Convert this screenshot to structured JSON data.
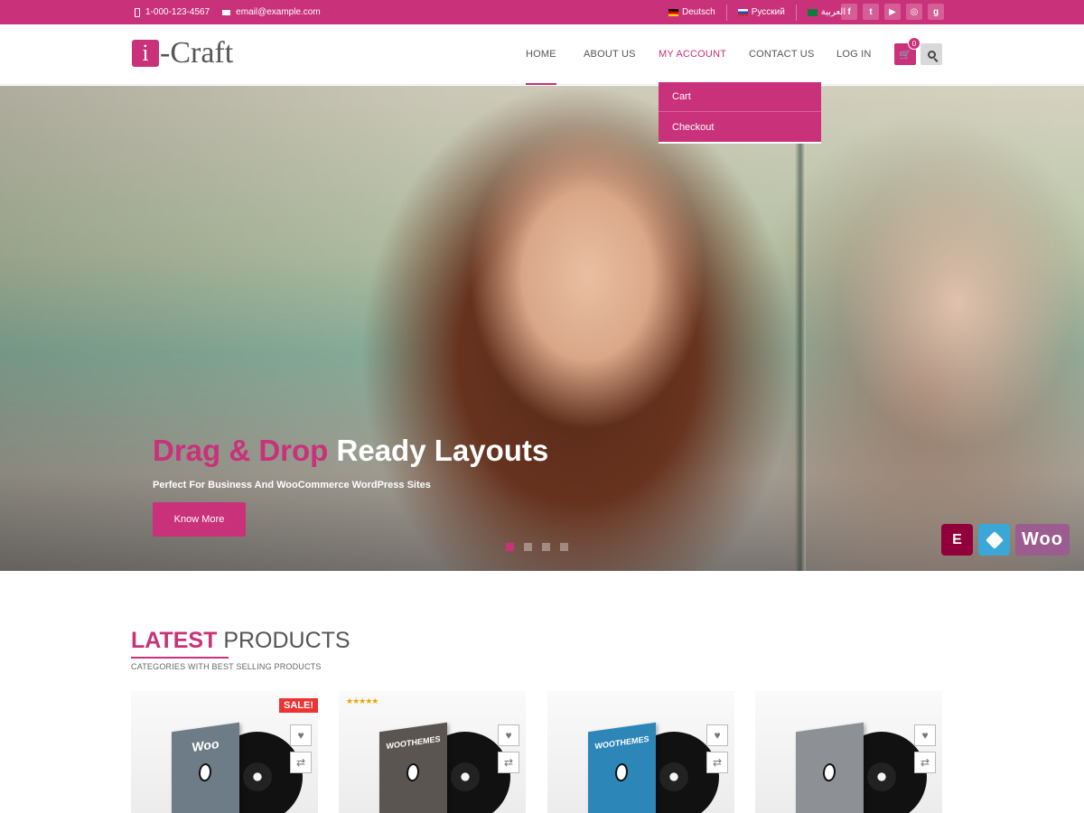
{
  "topbar": {
    "phone": "1-000-123-4567",
    "email": "email@example.com",
    "languages": [
      {
        "label": "Deutsch",
        "flag": "de-flag-icon"
      },
      {
        "label": "Русский",
        "flag": "ru-flag-icon"
      },
      {
        "label": "العربية",
        "flag": "sa-flag-icon"
      }
    ],
    "social": [
      {
        "icon": "facebook-icon",
        "glyph": "f"
      },
      {
        "icon": "twitter-icon",
        "glyph": "t"
      },
      {
        "icon": "youtube-icon",
        "glyph": "▶"
      },
      {
        "icon": "instagram-icon",
        "glyph": "◎"
      },
      {
        "icon": "google-plus-icon",
        "glyph": "g"
      }
    ]
  },
  "header": {
    "logo_letter": "i",
    "logo_text": "-Craft",
    "nav": [
      "HOME",
      "ABOUT US",
      "MY ACCOUNT",
      "CONTACT US",
      "LOG IN"
    ],
    "cart_count": "0"
  },
  "dropdown": {
    "items": [
      "Cart",
      "Checkout"
    ]
  },
  "hero": {
    "title_accent": "Drag & Drop",
    "title_rest": "Ready Layouts",
    "subtitle": "Perfect For Business And WooCommerce WordPress Sites",
    "button": "Know More",
    "slides": 4,
    "active_slide": 1,
    "badges": [
      "elementor-icon",
      "layers-icon",
      "woo-icon"
    ],
    "woo_text": "Woo",
    "elementor_glyph": "E"
  },
  "products": {
    "title_accent": "LATEST",
    "title_rest": "PRODUCTS",
    "subtitle": "CATEGORIES WITH BEST SELLING PRODUCTS",
    "sale_label": "SALE!",
    "stars": "★★★★★",
    "cards": [
      {
        "sleeve_text": "Woo",
        "sleeve_color": "#6d7c86",
        "sale": true,
        "rated": false
      },
      {
        "sleeve_text": "WOOTHEMES",
        "sleeve_color": "#5a5550",
        "sale": false,
        "rated": true
      },
      {
        "sleeve_text": "WOOTHEMES",
        "sleeve_color": "#2c86b8",
        "sale": false,
        "rated": false
      },
      {
        "sleeve_text": "",
        "sleeve_color": "#8d9094",
        "sale": false,
        "rated": false
      }
    ]
  },
  "colors": {
    "brand": "#c9317a",
    "topbar": "#c9317a"
  }
}
